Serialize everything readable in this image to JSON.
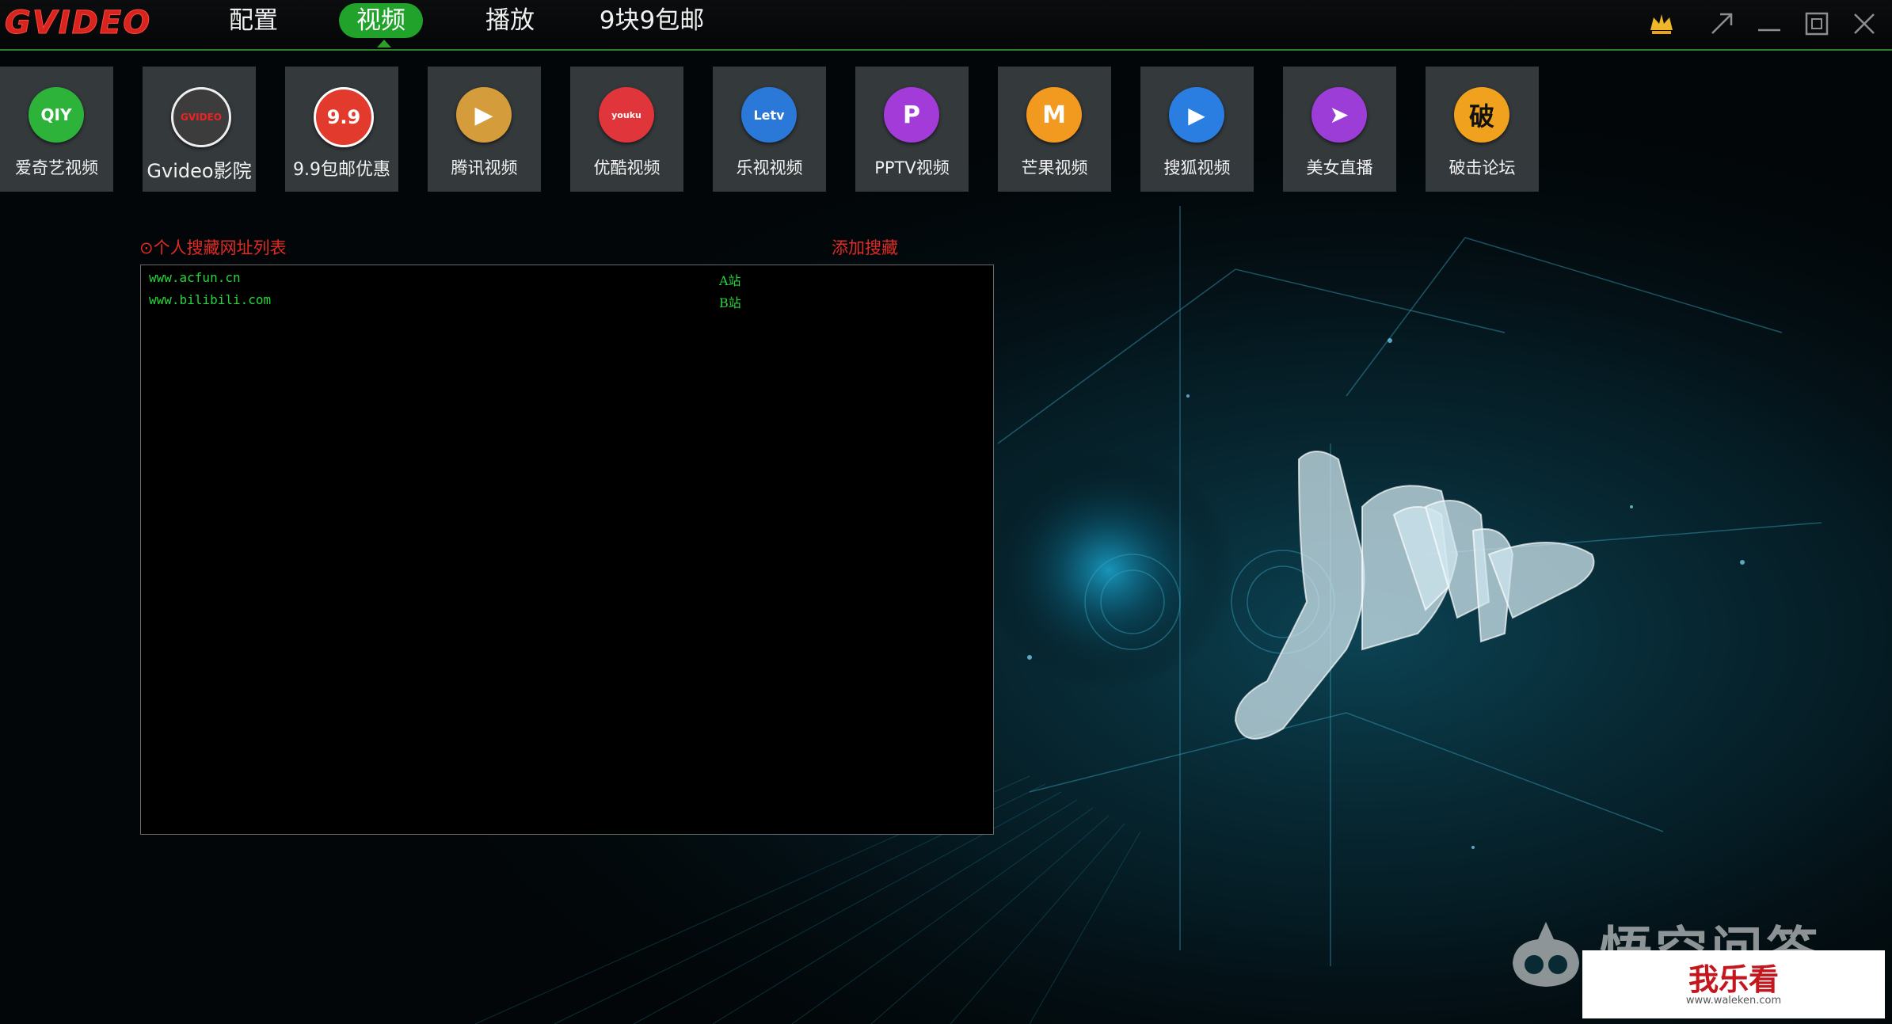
{
  "app": {
    "logo": "GVIDEO",
    "tabs": [
      {
        "label": "配置",
        "active": false
      },
      {
        "label": "视频",
        "active": true
      },
      {
        "label": "播放",
        "active": false
      },
      {
        "label": "9块9包邮",
        "active": false
      }
    ],
    "window_controls": [
      "vip-crown-icon",
      "shrink-icon",
      "minimize-icon",
      "restore-icon",
      "close-icon"
    ],
    "accent_color": "#21a32b"
  },
  "sites": [
    {
      "label": "爱奇艺视频",
      "icon": "iqiyi-icon",
      "glyph": "QIY",
      "color": "#2db33a"
    },
    {
      "label": "Gvideo影院",
      "icon": "gvideo-play-icon",
      "glyph": "GVIDEO",
      "color": "#4a4a4a"
    },
    {
      "label": "9.9包邮优惠",
      "icon": "nine-nine-icon",
      "glyph": "9.9",
      "color": "#e23b2e"
    },
    {
      "label": "腾讯视频",
      "icon": "tencent-video-icon",
      "glyph": "▶",
      "color": "#d59c3b"
    },
    {
      "label": "优酷视频",
      "icon": "youku-icon",
      "glyph": "youku",
      "color": "#e0353a"
    },
    {
      "label": "乐视视频",
      "icon": "letv-icon",
      "glyph": "Letv",
      "color": "#2a78d8"
    },
    {
      "label": "PPTV视频",
      "icon": "pptv-icon",
      "glyph": "P",
      "color": "#a33bd9"
    },
    {
      "label": "芒果视频",
      "icon": "mango-tv-icon",
      "glyph": "M",
      "color": "#f29a1f"
    },
    {
      "label": "搜狐视频",
      "icon": "sohu-video-icon",
      "glyph": "▶",
      "color": "#2a7de1"
    },
    {
      "label": "美女直播",
      "icon": "live-stream-icon",
      "glyph": "➤",
      "color": "#9b3dd6"
    },
    {
      "label": "破击论坛",
      "icon": "forum-icon",
      "glyph": "破",
      "color": "#f0a21e"
    }
  ],
  "favorites": {
    "title": "⊙个人搜藏网址列表",
    "add_label": "添加搜藏",
    "items": [
      {
        "url": "www.acfun.cn",
        "name": "A站"
      },
      {
        "url": "www.bilibili.com",
        "name": "B站"
      }
    ]
  },
  "watermarks": {
    "wukong": "悟空问答",
    "site_name": "我乐看",
    "site_url": "www.waleken.com"
  }
}
